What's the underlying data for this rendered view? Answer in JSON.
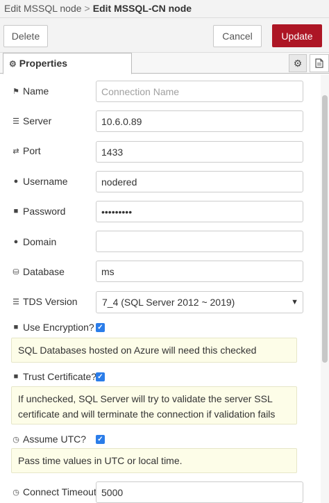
{
  "breadcrumb": {
    "parent": "Edit MSSQL node",
    "separator": ">",
    "current": "Edit MSSQL-CN node"
  },
  "toolbar": {
    "delete_label": "Delete",
    "cancel_label": "Cancel",
    "update_label": "Update",
    "update_color": "#ad1625"
  },
  "tabs": {
    "properties_label": "Properties",
    "properties_icon": "gear-icon",
    "settings_icon": "gear-icon",
    "description_icon": "document-icon"
  },
  "form": {
    "name": {
      "label": "Name",
      "icon": "tag-icon",
      "value": "",
      "placeholder": "Connection Name"
    },
    "server": {
      "label": "Server",
      "icon": "server-icon",
      "value": "10.6.0.89"
    },
    "port": {
      "label": "Port",
      "icon": "random-icon",
      "value": "1433"
    },
    "username": {
      "label": "Username",
      "icon": "user-icon",
      "value": "nodered"
    },
    "password": {
      "label": "Password",
      "icon": "lock-icon",
      "value": "•••••••••"
    },
    "domain": {
      "label": "Domain",
      "icon": "user-icon",
      "value": ""
    },
    "database": {
      "label": "Database",
      "icon": "database-icon",
      "value": "ms"
    },
    "tds_version": {
      "label": "TDS Version",
      "icon": "list-icon",
      "value": "7_4 (SQL Server 2012 ~ 2019)"
    },
    "use_encryption": {
      "label": "Use Encryption?",
      "icon": "lock-icon",
      "checked": true,
      "note": "SQL Databases hosted on Azure will need this checked"
    },
    "trust_certificate": {
      "label": "Trust Certificate?",
      "icon": "lock-icon",
      "checked": true,
      "note": "If unchecked, SQL Server will try to validate the server SSL certificate and will terminate the connection if validation fails"
    },
    "assume_utc": {
      "label": "Assume UTC?",
      "icon": "clock-icon",
      "checked": true,
      "note": "Pass time values in UTC or local time."
    },
    "connect_timeout": {
      "label": "Connect Timeout",
      "icon": "clock-icon",
      "value": "5000"
    }
  }
}
